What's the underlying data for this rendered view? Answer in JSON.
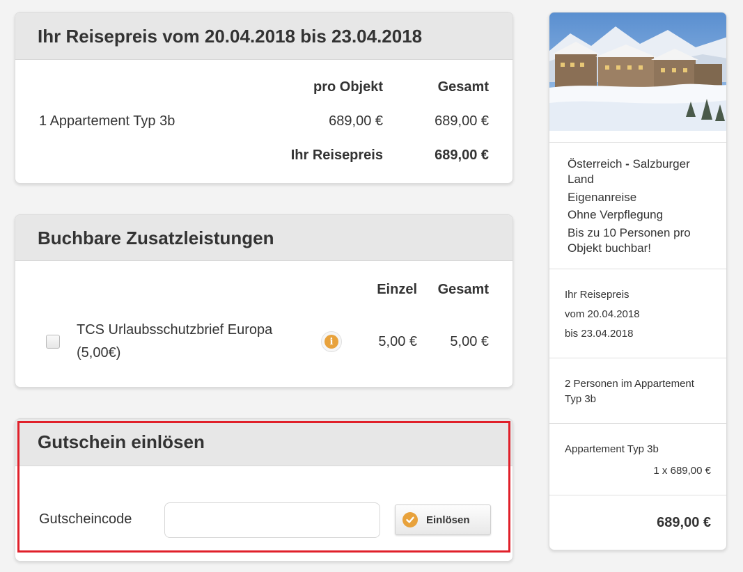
{
  "price_card": {
    "title": "Ihr Reisepreis vom 20.04.2018 bis 23.04.2018",
    "col_per_object": "pro Objekt",
    "col_total": "Gesamt",
    "row_label": "1 Appartement Typ 3b",
    "row_per_object": "689,00 €",
    "row_total": "689,00 €",
    "sum_label": "Ihr Reisepreis",
    "sum_value": "689,00 €"
  },
  "extras_card": {
    "title": "Buchbare Zusatzleistungen",
    "col_single": "Einzel",
    "col_total": "Gesamt",
    "item_line1": "TCS Urlaubsschutzbrief Europa",
    "item_line2": "(5,00€)",
    "item_single": "5,00 €",
    "item_total": "5,00 €",
    "item_checked": false
  },
  "voucher_card": {
    "title": "Gutschein einlösen",
    "field_label": "Gutscheincode",
    "field_value": "",
    "field_placeholder": "",
    "button_label": "Einlösen"
  },
  "sidebar": {
    "region_a": "Österreich",
    "region_sep": " - ",
    "region_b": "Salzburger",
    "region_c": "Land",
    "travel": "Eigenanreise",
    "board": "Ohne Verpflegung",
    "capacity_1": "Bis zu 10 Personen pro",
    "capacity_2": "Objekt buchbar!",
    "price_label": "Ihr Reisepreis",
    "date_from": "vom 20.04.2018",
    "date_to": "bis 23.04.2018",
    "persons_1": "2 Personen im Appartement",
    "persons_2": "Typ 3b",
    "unit_name": "Appartement Typ 3b",
    "unit_price": "1 x 689,00 €",
    "total": "689,00 €"
  },
  "colors": {
    "accent_orange": "#e8a23c",
    "highlight_red": "#e0202a",
    "header_gray": "#e7e7e7"
  }
}
